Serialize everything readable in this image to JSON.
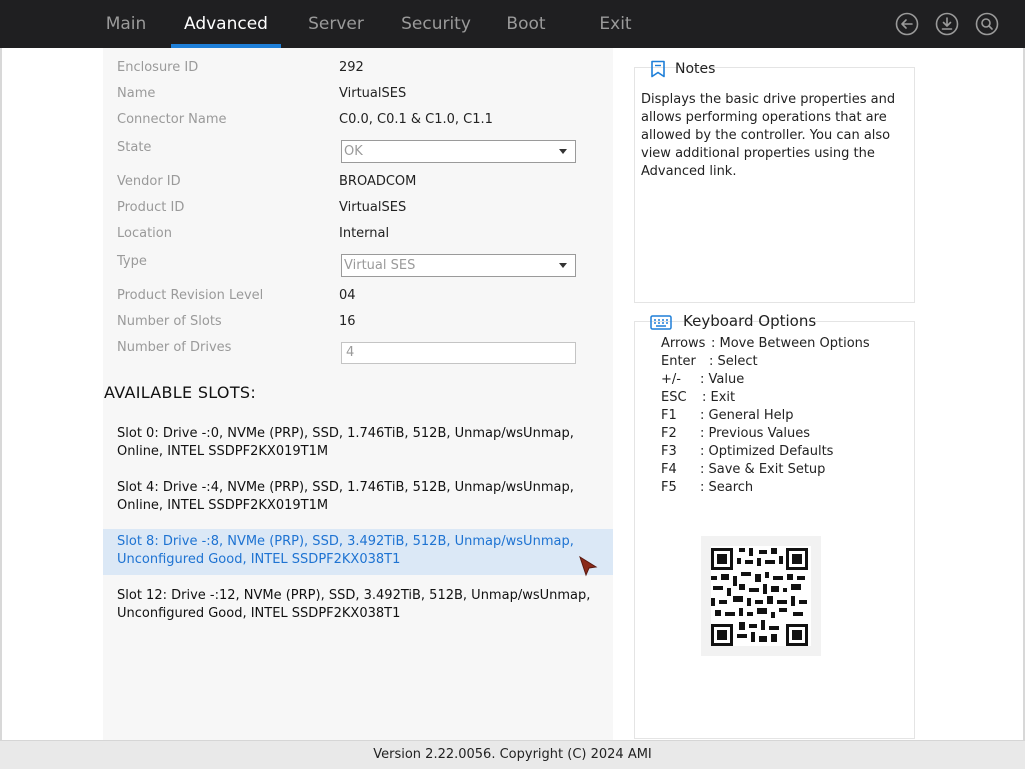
{
  "nav": {
    "tabs": [
      "Main",
      "Advanced",
      "Server",
      "Security",
      "Boot",
      "Exit"
    ],
    "active_tab": "Advanced",
    "icons": [
      "back-icon",
      "save-download-icon",
      "search-icon"
    ]
  },
  "fields": {
    "enclosure_id": {
      "label": "Enclosure ID",
      "value": "292"
    },
    "name": {
      "label": "Name",
      "value": "VirtualSES"
    },
    "connector_name": {
      "label": "Connector Name",
      "value": "C0.0, C0.1 & C1.0, C1.1"
    },
    "state": {
      "label": "State",
      "value": "OK"
    },
    "vendor_id": {
      "label": "Vendor ID",
      "value": "BROADCOM"
    },
    "product_id": {
      "label": "Product ID",
      "value": "VirtualSES"
    },
    "location": {
      "label": "Location",
      "value": "Internal"
    },
    "type": {
      "label": "Type",
      "value": "Virtual SES"
    },
    "product_revision": {
      "label": "Product Revision Level",
      "value": "04"
    },
    "num_slots": {
      "label": "Number of Slots",
      "value": "16"
    },
    "num_drives": {
      "label": "Number of Drives",
      "value": "4"
    }
  },
  "slots_heading": "AVAILABLE SLOTS:",
  "slots": [
    {
      "line1": "Slot 0: Drive -:0, NVMe (PRP), SSD, 1.746TiB, 512B, Unmap/wsUnmap,",
      "line2": "Online, INTEL SSDPF2KX019T1M"
    },
    {
      "line1": "Slot 4: Drive -:4, NVMe (PRP), SSD, 1.746TiB, 512B, Unmap/wsUnmap,",
      "line2": "Online, INTEL SSDPF2KX019T1M"
    },
    {
      "line1": "Slot 8: Drive -:8, NVMe (PRP), SSD, 3.492TiB, 512B, Unmap/wsUnmap,",
      "line2": "Unconfigured Good, INTEL SSDPF2KX038T1"
    },
    {
      "line1": "Slot 12: Drive -:12, NVMe (PRP), SSD, 3.492TiB, 512B, Unmap/wsUnmap,",
      "line2": "Unconfigured Good, INTEL SSDPF2KX038T1"
    }
  ],
  "notes": {
    "title": "Notes",
    "line1": "Displays the basic drive properties and",
    "line2": "allows performing operations that are",
    "line3": "allowed by the controller. You can also",
    "line4": "view additional properties using the",
    "line5": "Advanced link."
  },
  "keyboard": {
    "title": "Keyboard Options",
    "rows": [
      {
        "key": "Arrows",
        "desc": ": Move Between Options"
      },
      {
        "key": "Enter",
        "desc": ": Select"
      },
      {
        "key": "+/-",
        "desc": ": Value"
      },
      {
        "key": "ESC",
        "desc": ": Exit"
      },
      {
        "key": "F1",
        "desc": ": General Help"
      },
      {
        "key": "F2",
        "desc": ": Previous Values"
      },
      {
        "key": "F3",
        "desc": ": Optimized Defaults"
      },
      {
        "key": "F4",
        "desc": ": Save & Exit Setup"
      },
      {
        "key": "F5",
        "desc": ": Search"
      }
    ]
  },
  "footer": {
    "version": "Version 2.22.0056. Copyright (C) 2024 AMI"
  },
  "colors": {
    "accent": "#1e7fd8",
    "topbar": "#1f1f21",
    "selected_row": "#dbe8f6",
    "selected_text": "#1e73d2"
  }
}
